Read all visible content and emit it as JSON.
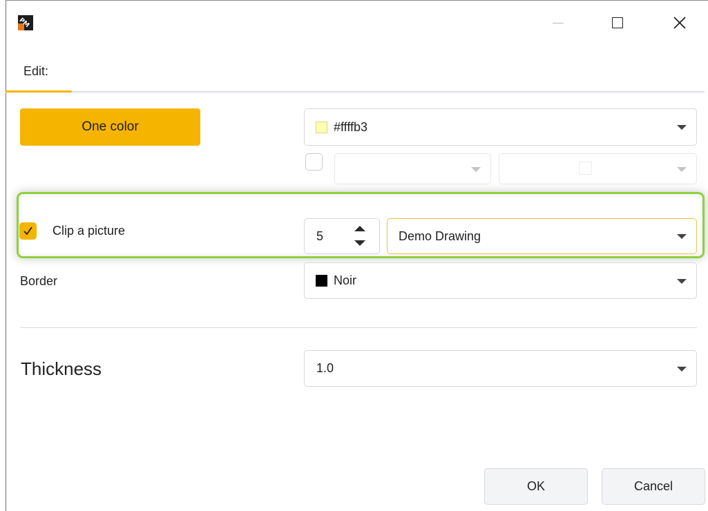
{
  "titlebar": {
    "app_icon": "pm-app-icon",
    "minimize_icon": "minimize-icon",
    "maximize_icon": "maximize-icon",
    "close_icon": "close-icon"
  },
  "tab": {
    "label": "Edit:"
  },
  "fill": {
    "mode_button_label": "One color",
    "color_value": "#ffffb3",
    "color_swatch": "#ffffb3",
    "secondary_checked": false
  },
  "clip": {
    "checked": true,
    "label": "Clip a picture",
    "count_value": "5",
    "picture_value": "Demo Drawing"
  },
  "border": {
    "label": "Border",
    "color_value": "Noir",
    "color_swatch": "#000000"
  },
  "thickness": {
    "label": "Thickness",
    "value": "1.0"
  },
  "buttons": {
    "ok": "OK",
    "cancel": "Cancel"
  },
  "colors": {
    "accent": "#f5b400",
    "highlight": "#8dd13c"
  }
}
